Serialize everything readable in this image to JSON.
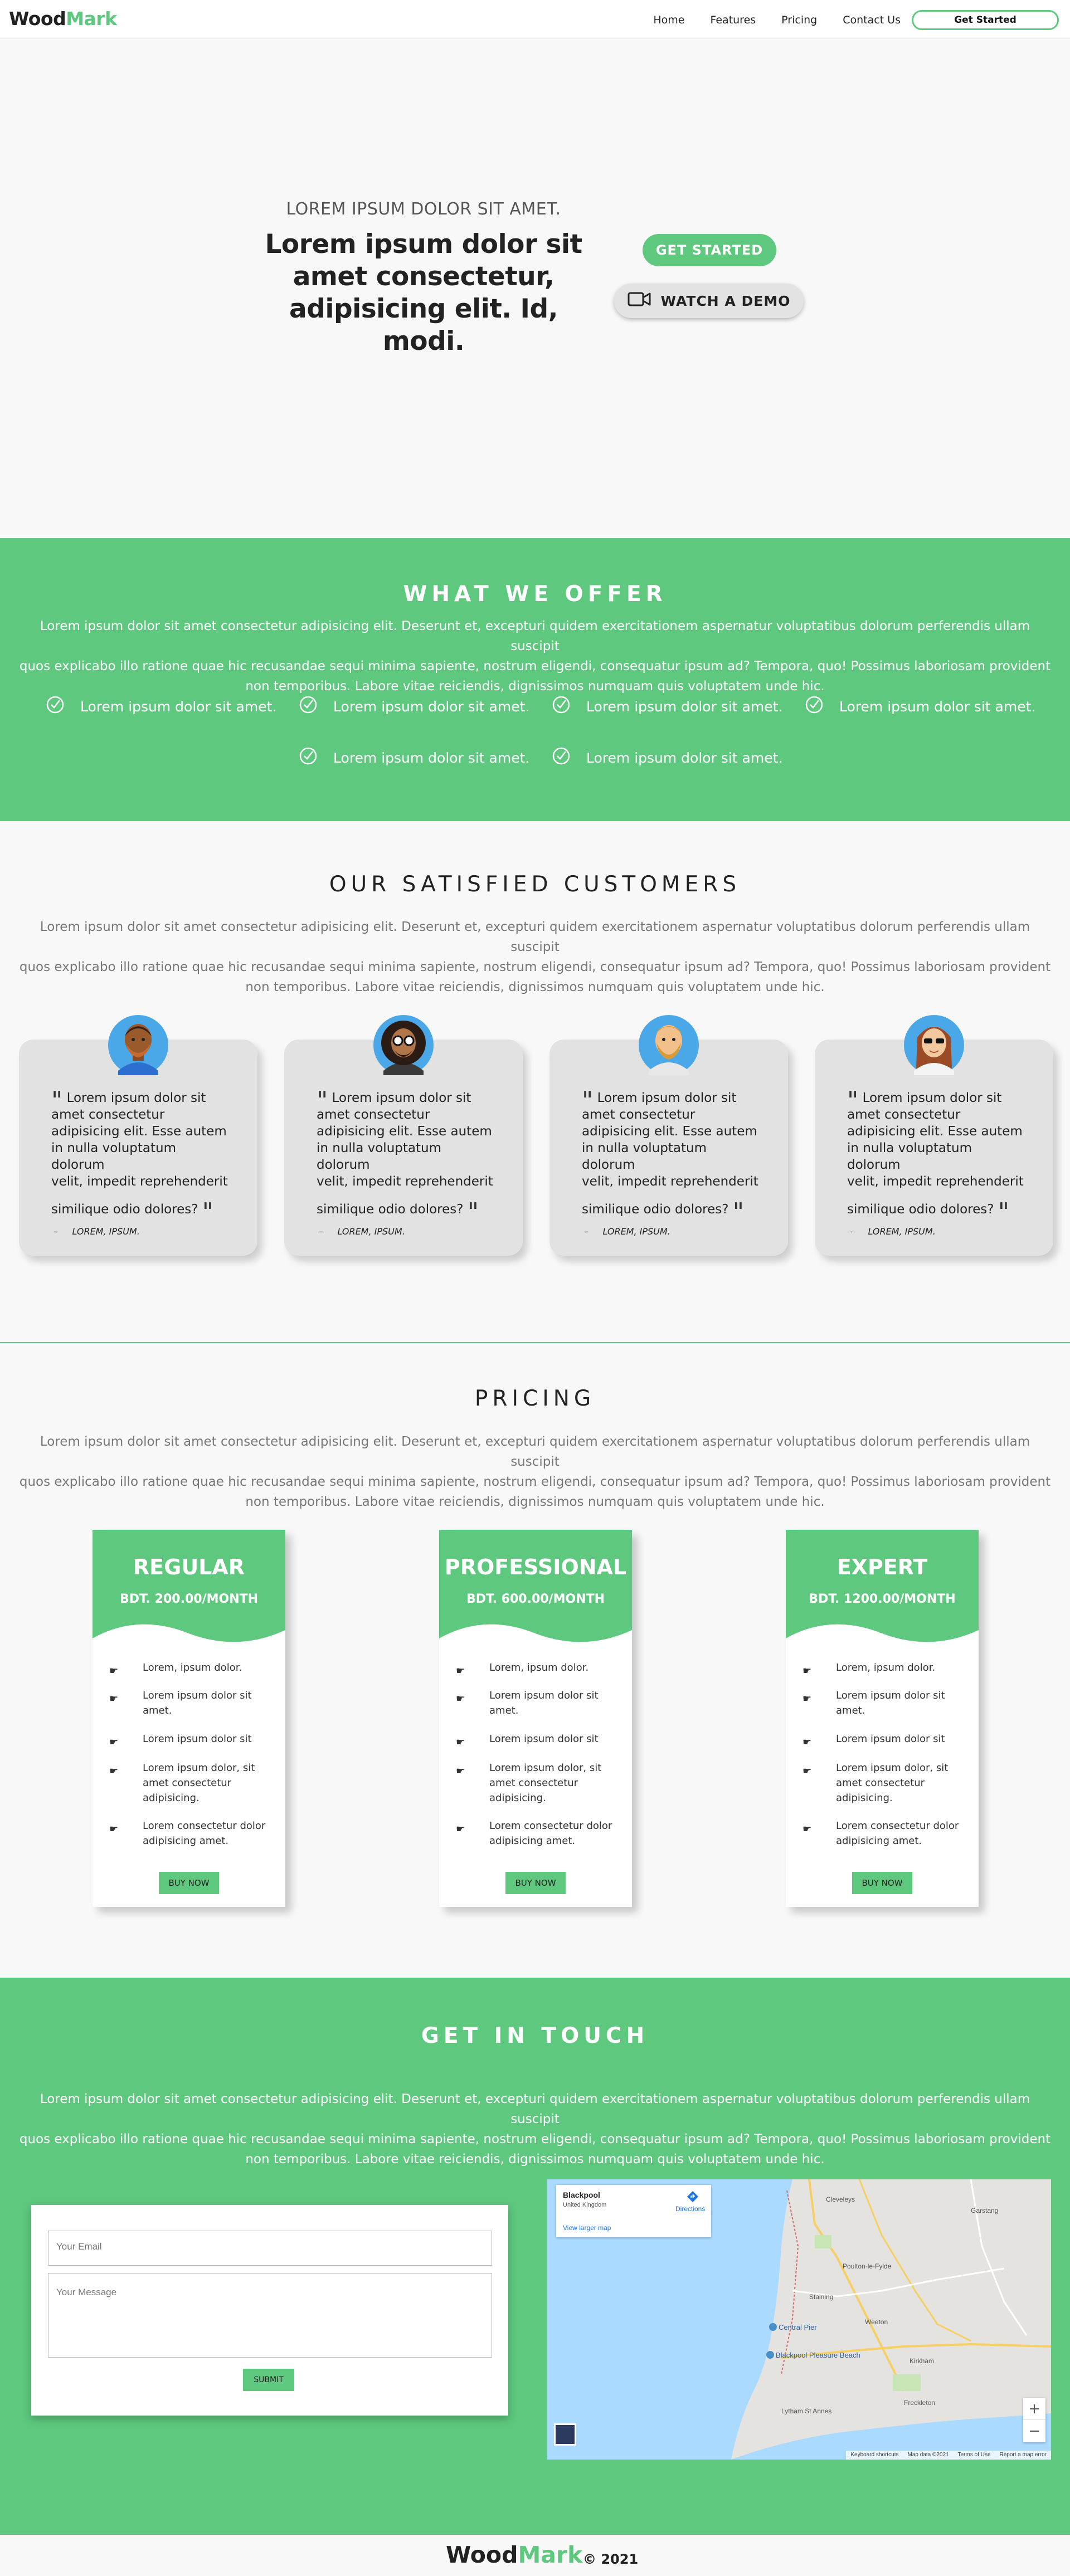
{
  "brand": {
    "part1": "Wood",
    "part2": "Mark",
    "accent": "#5dc87e"
  },
  "nav": {
    "links": [
      "Home",
      "Features",
      "Pricing",
      "Contact Us"
    ],
    "cta": "Get Started"
  },
  "hero": {
    "subtitle": "LOREM IPSUM DOLOR SIT AMET.",
    "title_lines": [
      "Lorem ipsum dolor sit",
      "amet consectetur,",
      "adipisicing elit. Id, modi."
    ],
    "btn_start": "GET STARTED",
    "btn_demo": "WATCH A DEMO"
  },
  "offer": {
    "title": "WHAT WE OFFER",
    "desc_lines": [
      "Lorem ipsum dolor sit amet consectetur adipisicing elit. Deserunt et, excepturi quidem exercitationem aspernatur voluptatibus dolorum perferendis ullam suscipit",
      "quos explicabo illo ratione quae hic recusandae sequi minima sapiente, nostrum eligendi, consequatur ipsum ad? Tempora, quo! Possimus laboriosam provident",
      "non temporibus. Labore vitae reiciendis, dignissimos numquam quis voluptatem unde hic."
    ],
    "features": [
      "Lorem ipsum dolor sit amet.",
      "Lorem ipsum dolor sit amet.",
      "Lorem ipsum dolor sit amet.",
      "Lorem ipsum dolor sit amet.",
      "Lorem ipsum dolor sit amet.",
      "Lorem ipsum dolor sit amet."
    ]
  },
  "customers": {
    "title": "OUR SATISFIED CUSTOMERS",
    "desc_lines": [
      "Lorem ipsum dolor sit amet consectetur adipisicing elit. Deserunt et, excepturi quidem exercitationem aspernatur voluptatibus dolorum perferendis ullam suscipit",
      "quos explicabo illo ratione quae hic recusandae sequi minima sapiente, nostrum eligendi, consequatur ipsum ad? Tempora, quo! Possimus laboriosam provident",
      "non temporibus. Labore vitae reiciendis, dignissimos numquam quis voluptatem unde hic."
    ],
    "testimonials": [
      {
        "lines": [
          "Lorem ipsum dolor sit",
          "amet consectetur",
          "adipisicing elit. Esse autem",
          "in nulla voluptatum dolorum",
          "velit, impedit reprehenderit",
          "similique odio dolores?"
        ],
        "author": "LOREM, IPSUM."
      },
      {
        "lines": [
          "Lorem ipsum dolor sit",
          "amet consectetur",
          "adipisicing elit. Esse autem",
          "in nulla voluptatum dolorum",
          "velit, impedit reprehenderit",
          "similique odio dolores?"
        ],
        "author": "LOREM, IPSUM."
      },
      {
        "lines": [
          "Lorem ipsum dolor sit",
          "amet consectetur",
          "adipisicing elit. Esse autem",
          "in nulla voluptatum dolorum",
          "velit, impedit reprehenderit",
          "similique odio dolores?"
        ],
        "author": "LOREM, IPSUM."
      },
      {
        "lines": [
          "Lorem ipsum dolor sit",
          "amet consectetur",
          "adipisicing elit. Esse autem",
          "in nulla voluptatum dolorum",
          "velit, impedit reprehenderit",
          "similique odio dolores?"
        ],
        "author": "LOREM, IPSUM."
      }
    ]
  },
  "pricing": {
    "title": "PRICING",
    "desc_lines": [
      "Lorem ipsum dolor sit amet consectetur adipisicing elit. Deserunt et, excepturi quidem exercitationem aspernatur voluptatibus dolorum perferendis ullam suscipit",
      "quos explicabo illo ratione quae hic recusandae sequi minima sapiente, nostrum eligendi, consequatur ipsum ad? Tempora, quo! Possimus laboriosam provident",
      "non temporibus. Labore vitae reiciendis, dignissimos numquam quis voluptatem unde hic."
    ],
    "plans": [
      {
        "name": "REGULAR",
        "price": "BDT. 200.00/MONTH",
        "button": "BUY NOW"
      },
      {
        "name": "PROFESSIONAL",
        "price": "BDT. 600.00/MONTH",
        "button": "BUY NOW"
      },
      {
        "name": "EXPERT",
        "price": "BDT. 1200.00/MONTH",
        "button": "BUY NOW"
      }
    ],
    "features": [
      [
        "Lorem, ipsum dolor."
      ],
      [
        "Lorem ipsum dolor sit",
        "amet."
      ],
      [
        "Lorem ipsum dolor sit"
      ],
      [
        "Lorem ipsum dolor, sit",
        "amet consectetur",
        "adipisicing."
      ],
      [
        "Lorem consectetur dolor",
        "adipisicing amet."
      ]
    ]
  },
  "contact": {
    "title": "GET IN TOUCH",
    "desc_lines": [
      "Lorem ipsum dolor sit amet consectetur adipisicing elit. Deserunt et, excepturi quidem exercitationem aspernatur voluptatibus dolorum perferendis ullam suscipit",
      "quos explicabo illo ratione quae hic recusandae sequi minima sapiente, nostrum eligendi, consequatur ipsum ad? Tempora, quo! Possimus laboriosam provident",
      "non temporibus. Labore vitae reiciendis, dignissimos numquam quis voluptatem unde hic."
    ],
    "email_placeholder": "Your Email",
    "message_placeholder": "Your Message",
    "submit": "SUBMIT"
  },
  "map": {
    "place": "Blackpool",
    "country": "United Kingdom",
    "directions": "Directions",
    "larger": "View larger map",
    "labels": [
      "Central Pier",
      "Blackpool Pleasure Beach",
      "Poulton-le-Fylde",
      "Cleveleys",
      "Lytham St Annes",
      "Freckleton",
      "Kirkham",
      "Weeton",
      "Staining",
      "Garstang"
    ],
    "footer_items": [
      "Keyboard shortcuts",
      "Map data ©2021",
      "Terms of Use",
      "Report a map error"
    ],
    "zoom_in": "+",
    "zoom_out": "−"
  },
  "footer": {
    "year": "© 2021"
  }
}
